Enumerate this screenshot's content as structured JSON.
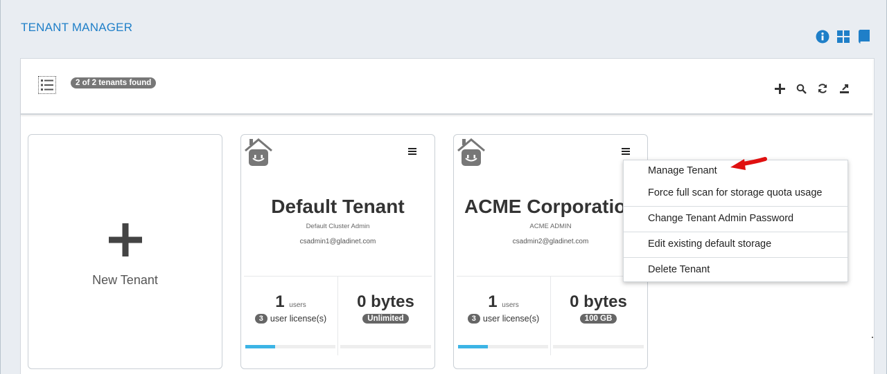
{
  "page": {
    "title": "TENANT MANAGER"
  },
  "header_icons": [
    "info-icon",
    "grid-view-icon",
    "book-icon"
  ],
  "toolbar": {
    "count_badge": "2 of 2 tenants found",
    "icons": [
      "add-icon",
      "search-icon",
      "refresh-icon",
      "export-icon"
    ]
  },
  "new_tenant": {
    "label": "New Tenant"
  },
  "tenants": [
    {
      "name": "Default Tenant",
      "admin": "Default Cluster Admin",
      "email": "csadmin1@gladinet.com",
      "users": "1",
      "users_label": "users",
      "licenses": "3",
      "licenses_label": "user license(s)",
      "storage": "0 bytes",
      "quota": "Unlimited",
      "license_usage": 0.33,
      "storage_usage": 0
    },
    {
      "name": "ACME Corporation",
      "admin": "ACME ADMIN",
      "email": "csadmin2@gladinet.com",
      "users": "1",
      "users_label": "users",
      "licenses": "3",
      "licenses_label": "user license(s)",
      "storage": "0 bytes",
      "quota": "100 GB",
      "license_usage": 0.33,
      "storage_usage": 0
    }
  ],
  "context_menu": {
    "items": [
      "Manage Tenant",
      "Force full scan for storage quota usage",
      "Change Tenant Admin Password",
      "Edit existing default storage",
      "Delete Tenant"
    ]
  },
  "colors": {
    "accent": "#1f7fc8",
    "progress": "#3cb4e5",
    "badge": "#777777",
    "arrow": "#e01010",
    "background": "#e9edf2"
  }
}
